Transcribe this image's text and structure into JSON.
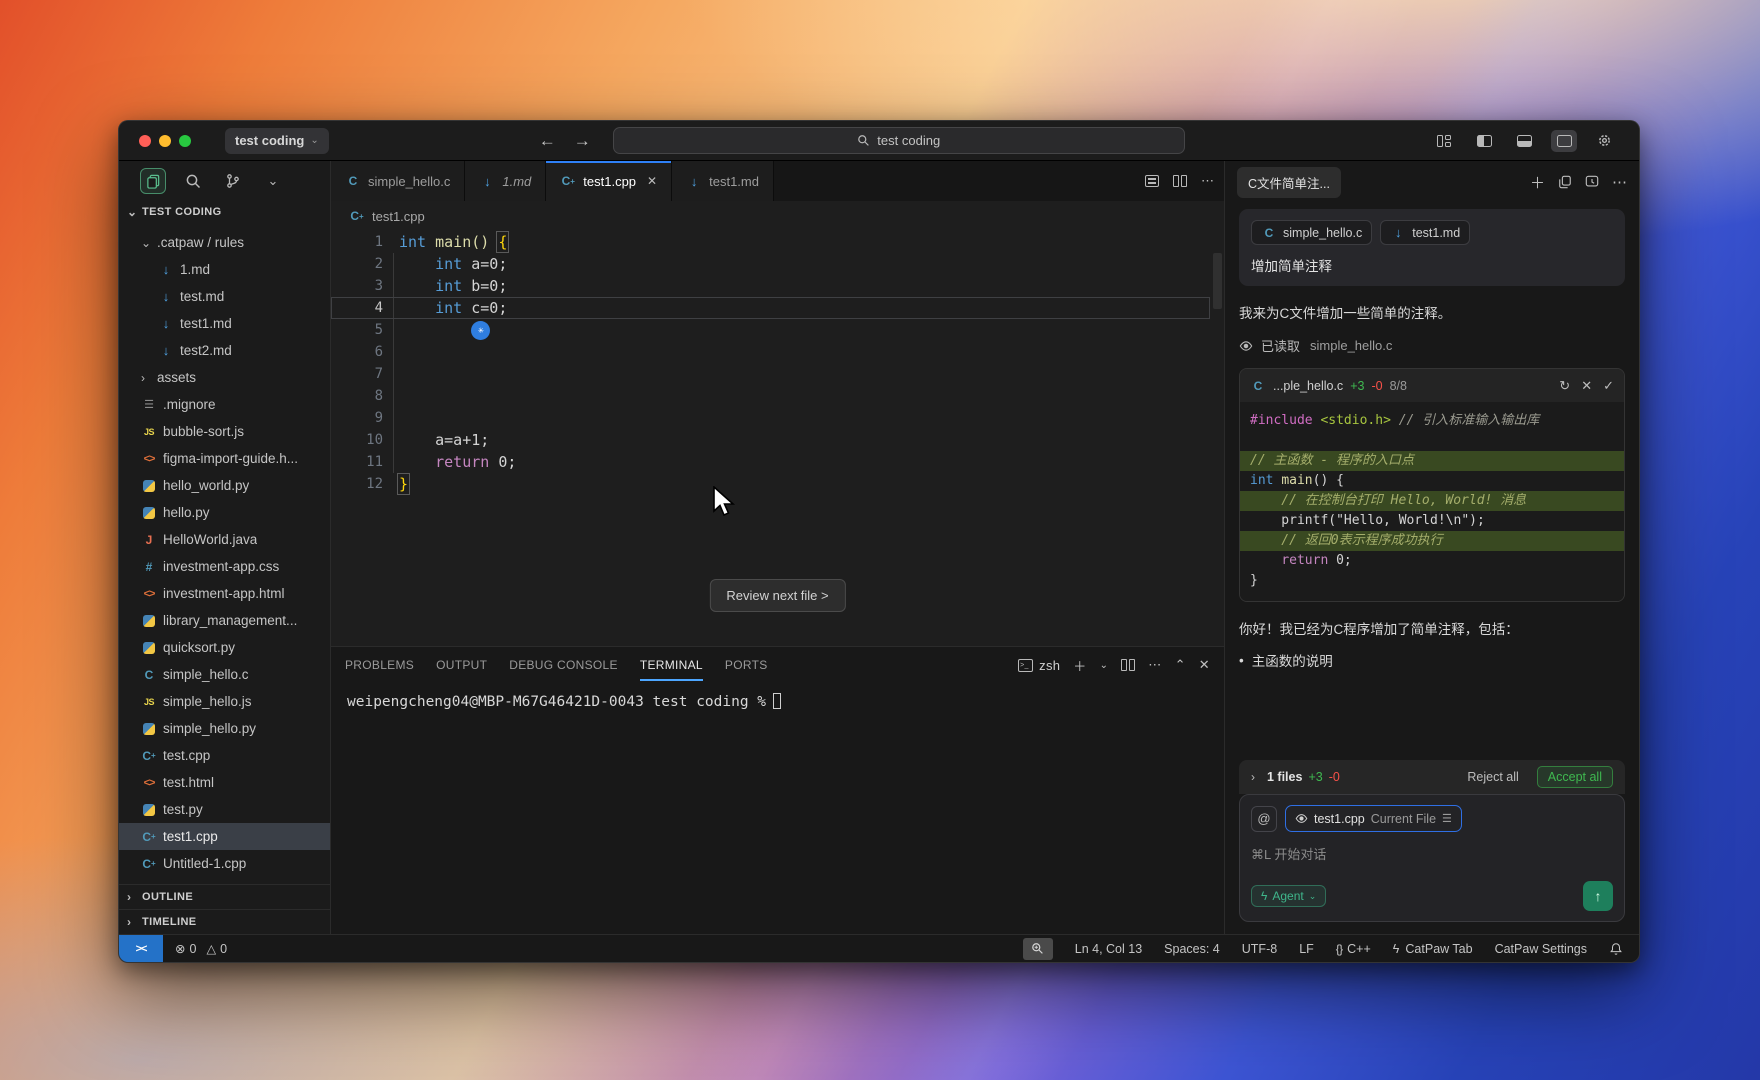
{
  "colors": {
    "accent_blue": "#2f81f7",
    "added_green": "#3fb950",
    "removed_red": "#f85149",
    "agent_green": "#3fb68b",
    "traffic": [
      "#ff5f57",
      "#febc2e",
      "#28c840"
    ]
  },
  "titlebar": {
    "project": "test coding",
    "search": "test coding"
  },
  "sidebar": {
    "section_title": "TEST CODING",
    "tree": [
      {
        "label": ".catpaw / rules",
        "chevron": "down",
        "icon": null,
        "level": 0
      },
      {
        "label": "1.md",
        "icon": "md",
        "level": 1
      },
      {
        "label": "test.md",
        "icon": "md",
        "level": 1
      },
      {
        "label": "test1.md",
        "icon": "md",
        "level": 1
      },
      {
        "label": "test2.md",
        "icon": "md",
        "level": 1
      },
      {
        "label": "assets",
        "chevron": "right",
        "icon": null,
        "level": 0
      },
      {
        "label": ".mignore",
        "icon": "ignore",
        "level": 0
      },
      {
        "label": "bubble-sort.js",
        "icon": "js",
        "level": 0
      },
      {
        "label": "figma-import-guide.h...",
        "icon": "html",
        "level": 0
      },
      {
        "label": "hello_world.py",
        "icon": "py",
        "level": 0
      },
      {
        "label": "hello.py",
        "icon": "py",
        "level": 0
      },
      {
        "label": "HelloWorld.java",
        "icon": "java",
        "level": 0
      },
      {
        "label": "investment-app.css",
        "icon": "css",
        "level": 0
      },
      {
        "label": "investment-app.html",
        "icon": "html",
        "level": 0
      },
      {
        "label": "library_management...",
        "icon": "py",
        "level": 0
      },
      {
        "label": "quicksort.py",
        "icon": "py",
        "level": 0
      },
      {
        "label": "simple_hello.c",
        "icon": "c",
        "level": 0
      },
      {
        "label": "simple_hello.js",
        "icon": "js",
        "level": 0
      },
      {
        "label": "simple_hello.py",
        "icon": "py",
        "level": 0
      },
      {
        "label": "test.cpp",
        "icon": "cpp",
        "level": 0
      },
      {
        "label": "test.html",
        "icon": "html",
        "level": 0
      },
      {
        "label": "test.py",
        "icon": "py",
        "level": 0
      },
      {
        "label": "test1.cpp",
        "icon": "cpp",
        "level": 0,
        "selected": true
      },
      {
        "label": "Untitled-1.cpp",
        "icon": "cpp",
        "level": 0
      }
    ],
    "bottom_sections": [
      "OUTLINE",
      "TIMELINE"
    ]
  },
  "editor_tabs": [
    {
      "label": "simple_hello.c",
      "icon": "c",
      "active": false,
      "italic": false,
      "close": false
    },
    {
      "label": "1.md",
      "icon": "md",
      "active": false,
      "italic": true,
      "close": false
    },
    {
      "label": "test1.cpp",
      "icon": "cpp",
      "active": true,
      "italic": false,
      "close": true
    },
    {
      "label": "test1.md",
      "icon": "md",
      "active": false,
      "italic": false,
      "close": false
    }
  ],
  "editor": {
    "breadcrumb": "test1.cpp",
    "close_glyph": "✕",
    "lines": [
      {
        "n": "1",
        "tokens": [
          [
            "int",
            "kw"
          ],
          [
            " ",
            ""
          ],
          [
            "main",
            "fn"
          ],
          [
            "()",
            "fn"
          ],
          [
            " ",
            ""
          ],
          [
            "{",
            "bracebox"
          ]
        ]
      },
      {
        "n": "2",
        "tokens": [
          [
            "    ",
            ""
          ],
          [
            "int",
            "kw"
          ],
          [
            " a=0;",
            ""
          ]
        ]
      },
      {
        "n": "3",
        "tokens": [
          [
            "    ",
            ""
          ],
          [
            "int",
            "kw"
          ],
          [
            " b=0;",
            ""
          ]
        ]
      },
      {
        "n": "4",
        "tokens": [
          [
            "    ",
            ""
          ],
          [
            "int",
            "kw"
          ],
          [
            " c=0;",
            ""
          ]
        ],
        "current": true
      },
      {
        "n": "5",
        "tokens": [],
        "widget": true
      },
      {
        "n": "6",
        "tokens": []
      },
      {
        "n": "7",
        "tokens": []
      },
      {
        "n": "8",
        "tokens": []
      },
      {
        "n": "9",
        "tokens": []
      },
      {
        "n": "10",
        "tokens": [
          [
            "    a=a+1;",
            ""
          ]
        ]
      },
      {
        "n": "11",
        "tokens": [
          [
            "    ",
            ""
          ],
          [
            "return",
            "kw2"
          ],
          [
            " 0;",
            ""
          ]
        ]
      },
      {
        "n": "12",
        "tokens": [
          [
            "}",
            "bracebox"
          ]
        ]
      }
    ],
    "review_button": "Review next file >"
  },
  "terminal": {
    "tabs": [
      "PROBLEMS",
      "OUTPUT",
      "DEBUG CONSOLE",
      "TERMINAL",
      "PORTS"
    ],
    "active_tab": "TERMINAL",
    "shell_label": "zsh",
    "prompt": "weipengcheng04@MBP-M67G46421D-0043 test coding %"
  },
  "assistant": {
    "tab_title": "C文件简单注...",
    "user_chips": [
      {
        "label": "simple_hello.c",
        "icon": "c"
      },
      {
        "label": "test1.md",
        "icon": "md"
      }
    ],
    "user_text": "增加简单注释",
    "intro": "我来为C文件增加一些简单的注释。",
    "read_label": "已读取",
    "read_file": "simple_hello.c",
    "diff": {
      "file": "...ple_hello.c",
      "added": "+3",
      "removed": "-0",
      "progress": "8/8",
      "refresh_glyph": "↻",
      "close_glyph": "✕",
      "check_glyph": "✓",
      "lines": [
        {
          "tokens": [
            [
              "#include",
              "pink"
            ],
            [
              " ",
              ""
            ],
            [
              "<stdio.h>",
              "green"
            ],
            [
              " ",
              ""
            ],
            [
              "// 引入标准输入输出库",
              "cmt"
            ]
          ]
        },
        {
          "tokens": []
        },
        {
          "added": true,
          "tokens": [
            [
              "// 主函数 - 程序的入口点",
              "cmt-add"
            ]
          ]
        },
        {
          "tokens": [
            [
              "int",
              "kw"
            ],
            [
              " ",
              ""
            ],
            [
              "main",
              "fn"
            ],
            [
              "() {",
              ""
            ]
          ]
        },
        {
          "added": true,
          "tokens": [
            [
              "    // 在控制台打印 Hello, World! 消息",
              "cmt-add"
            ]
          ]
        },
        {
          "tokens": [
            [
              "    printf(\"Hello, World!\\n\");",
              ""
            ]
          ]
        },
        {
          "added": true,
          "tokens": [
            [
              "    // 返回0表示程序成功执行",
              "cmt-add"
            ]
          ]
        },
        {
          "tokens": [
            [
              "    ",
              ""
            ],
            [
              "return",
              "kw2"
            ],
            [
              " 0;",
              ""
            ]
          ]
        },
        {
          "tokens": [
            [
              "}",
              ""
            ]
          ]
        }
      ]
    },
    "summary": "你好！我已经为C程序增加了简单注释，包括：",
    "bullets": [
      "主函数的说明"
    ],
    "files_bar": {
      "count": "1 files",
      "added": "+3",
      "removed": "-0",
      "reject_label": "Reject all",
      "accept_label": "Accept all"
    },
    "input": {
      "at_glyph": "@",
      "chip_file": "test1.cpp",
      "chip_mode": "Current File",
      "placeholder": "⌘L 开始对话",
      "agent_label": "Agent",
      "send_glyph": "↑"
    }
  },
  "statusbar": {
    "errors": "0",
    "warnings": "0",
    "cursor_position": "Ln 4, Col 13",
    "spaces": "Spaces: 4",
    "encoding": "UTF-8",
    "eol": "LF",
    "language": "C++",
    "catpaw_tab": "CatPaw Tab",
    "catpaw_settings": "CatPaw Settings"
  }
}
